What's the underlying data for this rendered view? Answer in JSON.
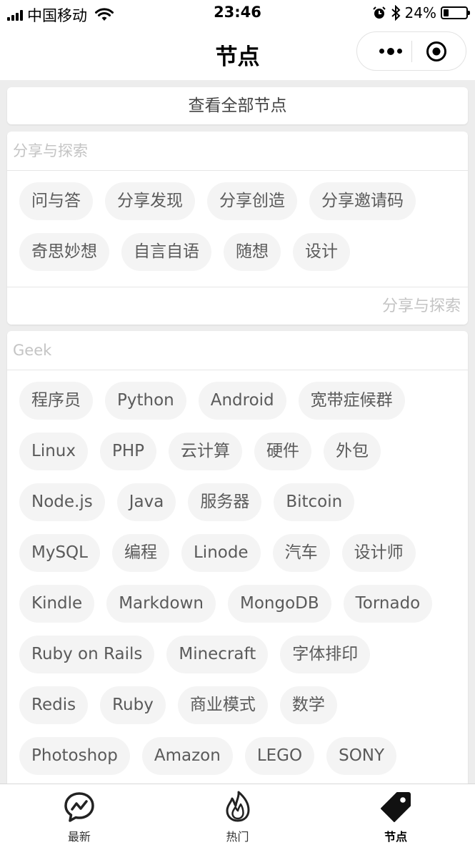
{
  "status_bar": {
    "carrier": "中国移动",
    "time": "23:46",
    "battery": "24%",
    "battery_level": 0.24
  },
  "nav": {
    "title": "节点"
  },
  "view_all_label": "查看全部节点",
  "sections": [
    {
      "title": "分享与探索",
      "tags": [
        "问与答",
        "分享发现",
        "分享创造",
        "分享邀请码",
        "奇思妙想",
        "自言自语",
        "随想",
        "设计"
      ],
      "footer": "分享与探索"
    },
    {
      "title": "Geek",
      "tags": [
        "程序员",
        "Python",
        "Android",
        "宽带症候群",
        "Linux",
        "PHP",
        "云计算",
        "硬件",
        "外包",
        "Node.js",
        "Java",
        "服务器",
        "Bitcoin",
        "MySQL",
        "编程",
        "Linode",
        "汽车",
        "设计师",
        "Kindle",
        "Markdown",
        "MongoDB",
        "Tornado",
        "Ruby on Rails",
        "Minecraft",
        "字体排印",
        "Redis",
        "Ruby",
        "商业模式",
        "数学",
        "Photoshop",
        "Amazon",
        "LEGO",
        "SONY"
      ]
    }
  ],
  "tabbar": [
    {
      "label": "最新",
      "icon": "chat-pulse-icon",
      "active": false
    },
    {
      "label": "热门",
      "icon": "flame-icon",
      "active": false
    },
    {
      "label": "节点",
      "icon": "tag-icon",
      "active": true
    }
  ]
}
